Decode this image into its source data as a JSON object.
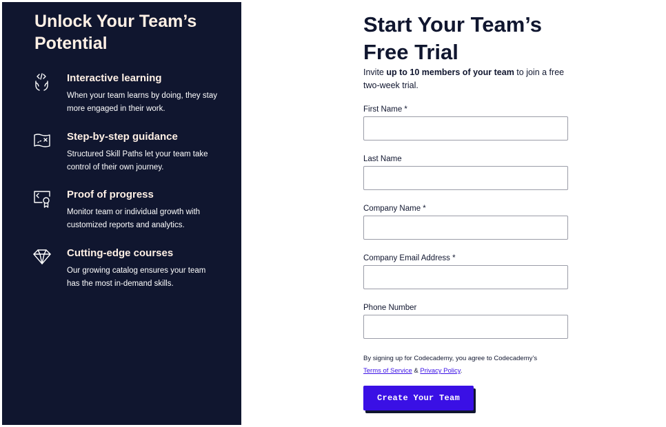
{
  "left_panel": {
    "heading": "Unlock Your Team’s Potential",
    "features": [
      {
        "icon": "code-hands-icon",
        "title": "Interactive learning",
        "description": "When your team learns by doing, they stay more engaged in their work."
      },
      {
        "icon": "treasure-map-icon",
        "title": "Step-by-step guidance",
        "description": "Structured Skill Paths let your team take control of their own journey."
      },
      {
        "icon": "certificate-icon",
        "title": "Proof of progress",
        "description": "Monitor team or individual growth with customized reports and analytics."
      },
      {
        "icon": "diamond-icon",
        "title": "Cutting-edge courses",
        "description": "Our growing catalog ensures your team has the most in-demand skills."
      }
    ]
  },
  "form": {
    "heading": "Start Your Team’s Free Trial",
    "intro_prefix": "Invite ",
    "intro_bold": "up to 10 members of your team",
    "intro_suffix": " to join a free two-week trial.",
    "fields": [
      {
        "label": "First Name *",
        "value": "",
        "placeholder": ""
      },
      {
        "label": "Last Name",
        "value": "",
        "placeholder": ""
      },
      {
        "label": "Company Name *",
        "value": "",
        "placeholder": ""
      },
      {
        "label": "Company Email Address *",
        "value": "",
        "placeholder": ""
      },
      {
        "label": "Phone Number",
        "value": "",
        "placeholder": ""
      }
    ],
    "legal_prefix": "By signing up for Codecademy, you agree to Codecademy’s",
    "terms_link": "Terms of Service",
    "legal_and": " & ",
    "privacy_link": "Privacy Policy",
    "legal_suffix": ".",
    "submit_label": "Create Your Team"
  },
  "colors": {
    "navy": "#10162f",
    "accent": "#3a10e5",
    "heading_cream": "#fff0e5"
  }
}
